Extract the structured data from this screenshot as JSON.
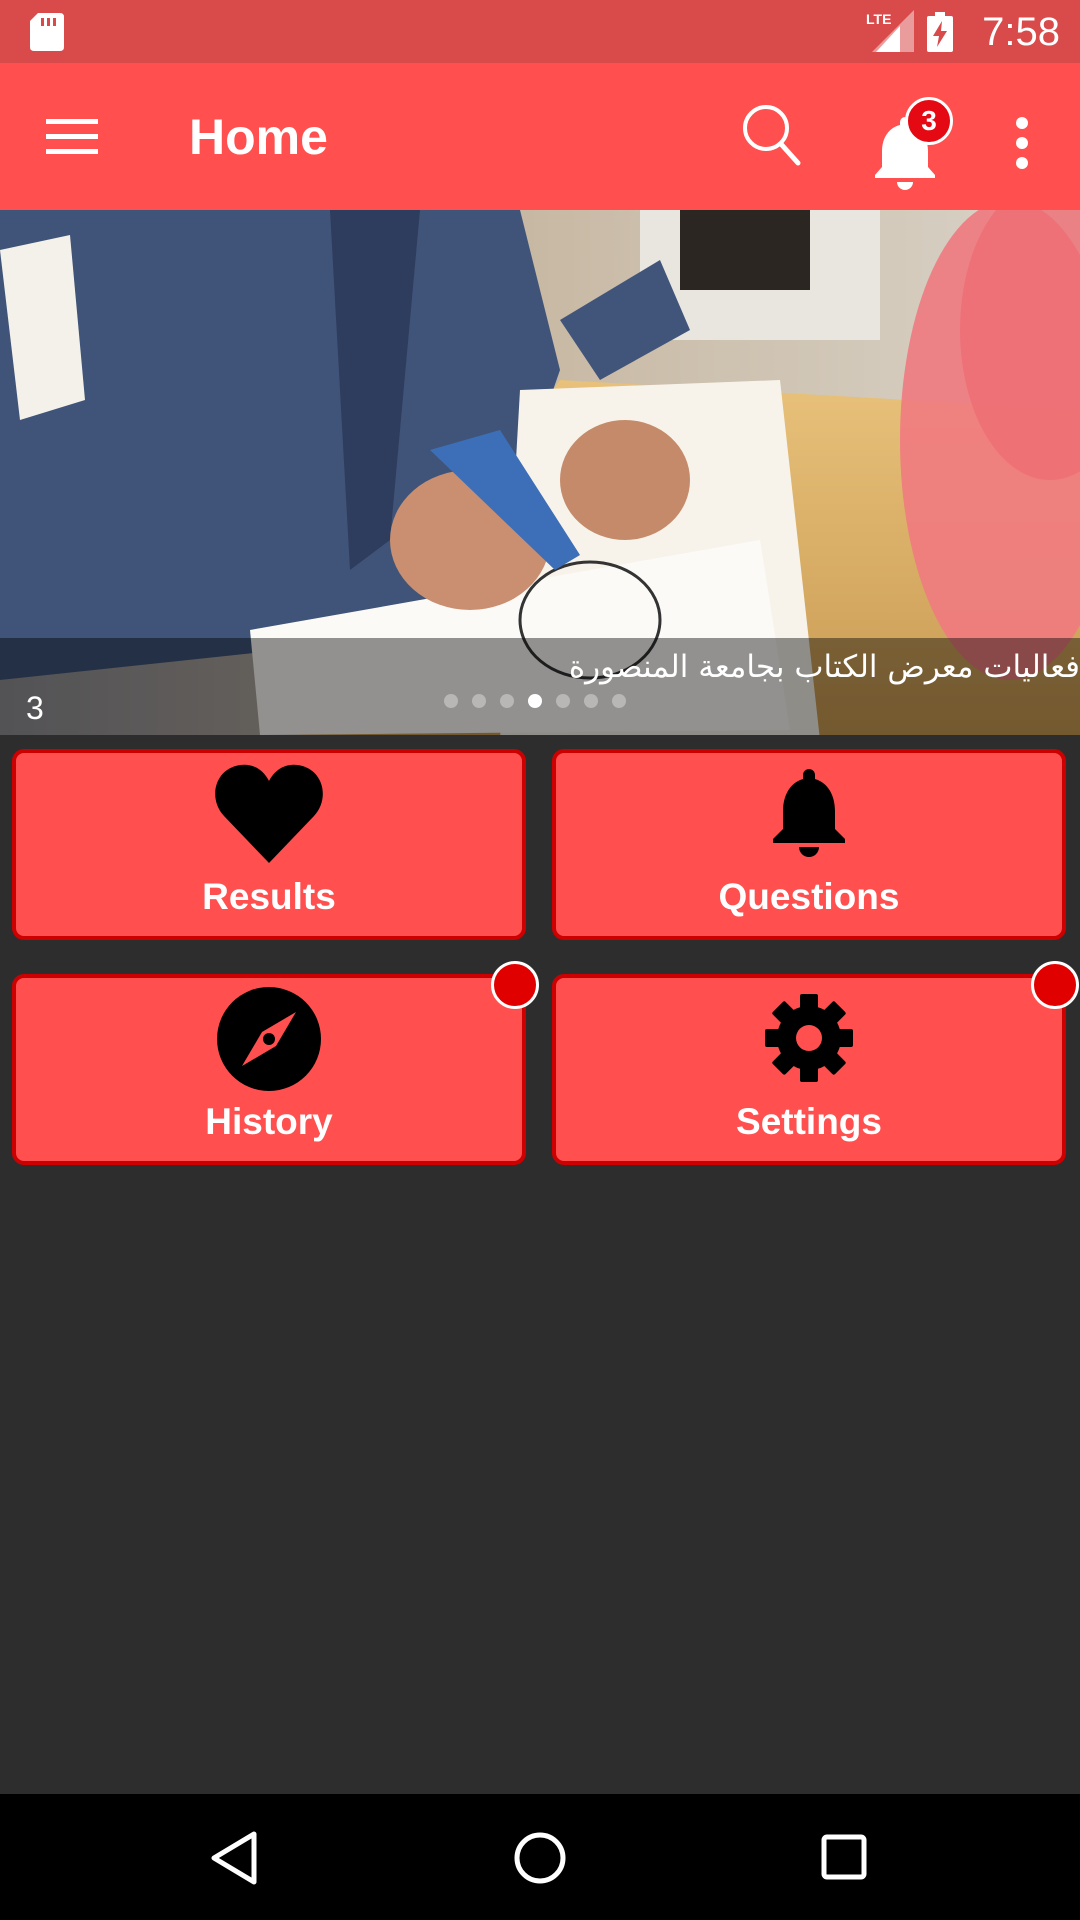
{
  "status_bar": {
    "network": "LTE",
    "time": "7:58",
    "icons": [
      "sd-card-icon",
      "lte-signal-icon",
      "battery-charging-icon"
    ]
  },
  "app_bar": {
    "title": "Home",
    "notification_count": "3",
    "icons": [
      "menu-icon",
      "search-icon",
      "bell-icon",
      "more-vert-icon"
    ]
  },
  "slider": {
    "caption": "فعاليات معرض الكتاب بجامعة المنصورة",
    "counter": "3",
    "slide_count": 7,
    "active_index": 3
  },
  "tiles": [
    {
      "label": "Results",
      "icon": "heart-icon",
      "has_dot": false
    },
    {
      "label": "Questions",
      "icon": "bell-icon",
      "has_dot": false
    },
    {
      "label": "History",
      "icon": "compass-icon",
      "has_dot": true
    },
    {
      "label": "Settings",
      "icon": "gear-icon",
      "has_dot": true
    }
  ],
  "nav_bar": {
    "icons": [
      "back-icon",
      "home-icon",
      "recents-icon"
    ]
  },
  "colors": {
    "status_bar": "#d94a4a",
    "app_bar": "#ff4f4f",
    "tile_fill": "#ff4f4f",
    "tile_border": "#cc0000",
    "background": "#2d2d2d",
    "badge": "#e50914"
  }
}
